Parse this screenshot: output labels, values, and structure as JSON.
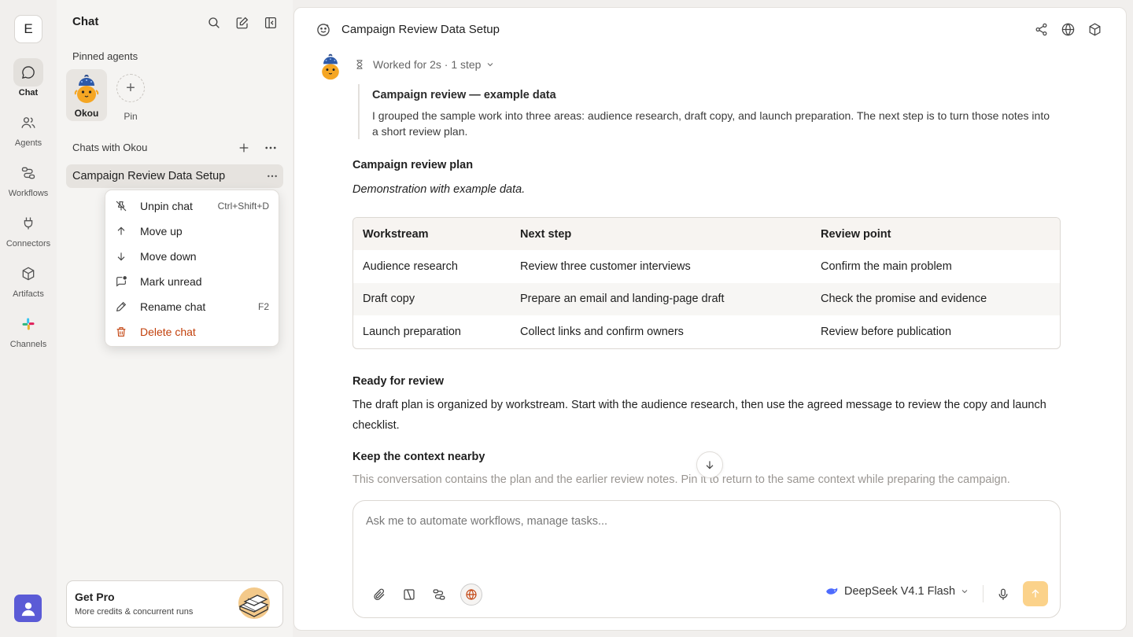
{
  "rail": {
    "workspace_letter": "E",
    "items": [
      {
        "label": "Chat",
        "icon": "chat-bubble-icon"
      },
      {
        "label": "Agents",
        "icon": "users-icon"
      },
      {
        "label": "Workflows",
        "icon": "workflow-icon"
      },
      {
        "label": "Connectors",
        "icon": "plug-icon"
      },
      {
        "label": "Artifacts",
        "icon": "cube-icon"
      },
      {
        "label": "Channels",
        "icon": "slack-icon"
      }
    ]
  },
  "sidebar": {
    "title": "Chat",
    "pinned_label": "Pinned agents",
    "pinned_agent": "Okou",
    "pin_label": "Pin",
    "chats_label": "Chats with Okou",
    "active_chat": "Campaign Review Data Setup",
    "get_pro": {
      "title": "Get Pro",
      "subtitle": "More credits & concurrent runs"
    }
  },
  "context_menu": {
    "items": [
      {
        "label": "Unpin chat",
        "shortcut": "Ctrl+Shift+D",
        "icon": "unpin-icon"
      },
      {
        "label": "Move up",
        "shortcut": "",
        "icon": "arrow-up-icon"
      },
      {
        "label": "Move down",
        "shortcut": "",
        "icon": "arrow-down-icon"
      },
      {
        "label": "Mark unread",
        "shortcut": "",
        "icon": "mark-unread-icon"
      },
      {
        "label": "Rename chat",
        "shortcut": "F2",
        "icon": "pencil-icon"
      },
      {
        "label": "Delete chat",
        "shortcut": "",
        "icon": "trash-icon"
      }
    ]
  },
  "main": {
    "title": "Campaign Review Data Setup",
    "worked": "Worked for 2s · 1 step",
    "quote_title": "Campaign review — example data",
    "quote_body": "I grouped the sample work into three areas: audience research, draft copy, and launch preparation. The next step is to turn those notes into a short review plan.",
    "plan_heading": "Campaign review plan",
    "plan_note": "Demonstration with example data.",
    "table": {
      "headers": [
        "Workstream",
        "Next step",
        "Review point"
      ],
      "rows": [
        [
          "Audience research",
          "Review three customer interviews",
          "Confirm the main problem"
        ],
        [
          "Draft copy",
          "Prepare an email and landing-page draft",
          "Check the promise and evidence"
        ],
        [
          "Launch preparation",
          "Collect links and confirm owners",
          "Review before publication"
        ]
      ]
    },
    "ready_heading": "Ready for review",
    "ready_body": "The draft plan is organized by workstream. Start with the audience research, then use the agreed message to review the copy and launch checklist.",
    "context_heading": "Keep the context nearby",
    "context_body": "This conversation contains the plan and the earlier review notes. Pin it to return to the same context while preparing the campaign."
  },
  "composer": {
    "placeholder": "Ask me to automate workflows, manage tasks...",
    "model": "DeepSeek V4.1 Flash"
  },
  "colors": {
    "accent": "#c2410c",
    "send_button": "#fbd28a",
    "user_avatar": "#5b5bd6"
  }
}
